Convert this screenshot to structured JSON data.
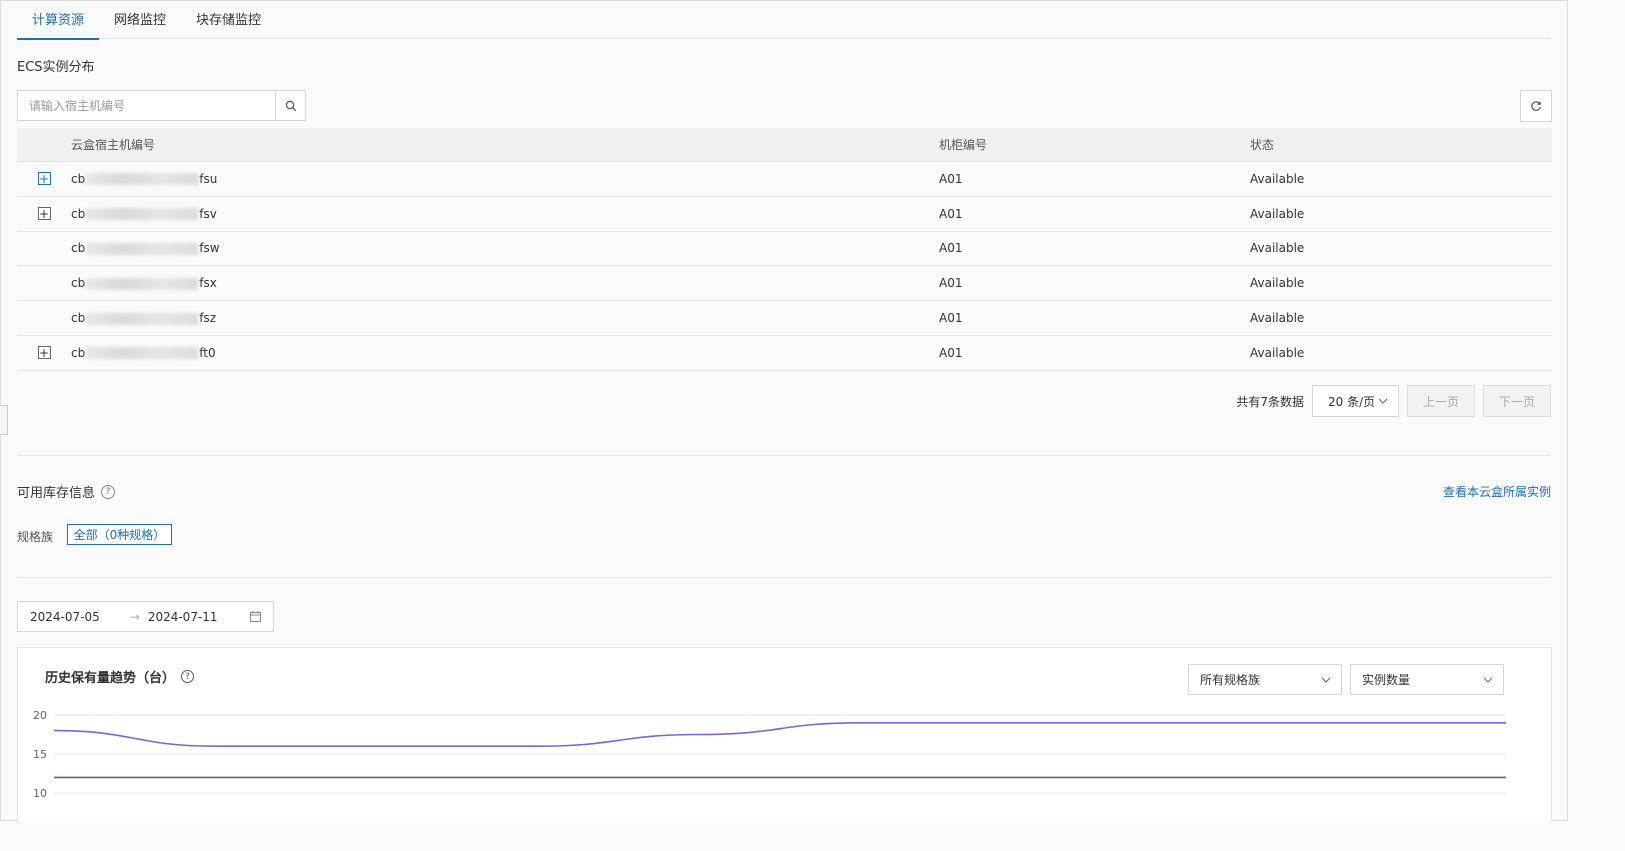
{
  "tabs": [
    "计算资源",
    "网络监控",
    "块存储监控"
  ],
  "section_title": "ECS实例分布",
  "search": {
    "placeholder": "请输入宿主机编号"
  },
  "table": {
    "headers": [
      "云盒宿主机编号",
      "机柜编号",
      "状态"
    ],
    "rows": [
      {
        "host_prefix": "cb",
        "host_suffix": "fsu",
        "cabinet": "A01",
        "status": "Available",
        "expandable": true,
        "expand_active": true
      },
      {
        "host_prefix": "cb",
        "host_suffix": "fsv",
        "cabinet": "A01",
        "status": "Available",
        "expandable": true,
        "expand_active": false
      },
      {
        "host_prefix": "cb",
        "host_suffix": "fsw",
        "cabinet": "A01",
        "status": "Available",
        "expandable": false,
        "expand_active": false
      },
      {
        "host_prefix": "cb",
        "host_suffix": "fsx",
        "cabinet": "A01",
        "status": "Available",
        "expandable": false,
        "expand_active": false
      },
      {
        "host_prefix": "cb",
        "host_suffix": "fsz",
        "cabinet": "A01",
        "status": "Available",
        "expandable": false,
        "expand_active": false
      },
      {
        "host_prefix": "cb",
        "host_suffix": "ft0",
        "cabinet": "A01",
        "status": "Available",
        "expandable": true,
        "expand_active": false
      }
    ]
  },
  "pagination": {
    "total": "共有7条数据",
    "page_size": "20 条/页",
    "prev": "上一页",
    "next": "下一页"
  },
  "stock": {
    "title": "可用库存信息",
    "link": "查看本云盒所属实例",
    "family_label": "规格族",
    "family_tag": "全部（0种规格）"
  },
  "date_range": {
    "start": "2024-07-05",
    "end": "2024-07-11"
  },
  "chart": {
    "title": "历史保有量趋势（台）",
    "select_family": "所有规格族",
    "select_metric": "实例数量"
  },
  "chart_data": {
    "type": "line",
    "title": "历史保有量趋势（台）",
    "y_ticks": [
      20,
      15,
      10
    ],
    "ylim": [
      10,
      20
    ],
    "grid": true,
    "series": [
      {
        "color": "#7b61e8",
        "values": [
          18,
          16,
          16,
          16,
          17.5,
          19,
          19,
          19,
          19,
          19
        ]
      },
      {
        "color": "#4a6a8f",
        "values": [
          12,
          12,
          12,
          12,
          12,
          12,
          12,
          12,
          12,
          12
        ]
      }
    ]
  },
  "colors": {
    "accent": "#1a6fc1",
    "series_purple": "#7b61e8",
    "series_steel": "#4a6a8f"
  }
}
